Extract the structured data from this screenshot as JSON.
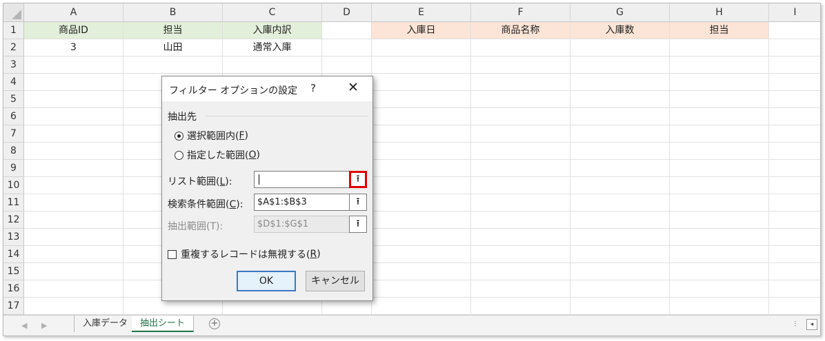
{
  "columns": [
    "A",
    "B",
    "C",
    "D",
    "E",
    "F",
    "G",
    "H",
    "I"
  ],
  "rows": [
    "1",
    "2",
    "3",
    "4",
    "5",
    "6",
    "7",
    "8",
    "9",
    "10",
    "11",
    "12",
    "13",
    "14",
    "15",
    "16",
    "17"
  ],
  "cells": {
    "A1": "商品ID",
    "B1": "担当",
    "C1": "入庫内訳",
    "E1": "入庫日",
    "F1": "商品名称",
    "G1": "入庫数",
    "H1": "担当",
    "A2": "3",
    "B2": "山田",
    "C2": "通常入庫"
  },
  "colors": {
    "criteria_header": "#e2efda",
    "output_header": "#fce4d6",
    "highlight": "#e00000",
    "active_tab": "#217346"
  },
  "dialog": {
    "title": "フィルター オプションの設定",
    "help": "?",
    "close": "✕",
    "group_label": "抽出先",
    "radio_in_place": {
      "text": "選択範囲内(",
      "key": "F",
      "end": ")",
      "checked": true
    },
    "radio_copy": {
      "text": "指定した範囲(",
      "key": "O",
      "end": ")",
      "checked": false
    },
    "list_range": {
      "text": "リスト範囲(",
      "key": "L",
      "end": "):",
      "value": ""
    },
    "criteria_range": {
      "text": "検索条件範囲(",
      "key": "C",
      "end": "):",
      "value": "$A$1:$B$3"
    },
    "copy_to": {
      "label": "抽出範囲(T):",
      "value": "$D$1:$G$1",
      "disabled": true
    },
    "unique_only": {
      "text": "重複するレコードは無視する(",
      "key": "R",
      "end": ")",
      "checked": false
    },
    "ok_label": "OK",
    "cancel_label": "キャンセル",
    "collapse_glyph": "⭱"
  },
  "sheets": {
    "tabs": [
      {
        "label": "入庫データ",
        "active": false
      },
      {
        "label": "抽出シート",
        "active": true
      }
    ],
    "add_glyph": "+",
    "nav_prev": "◀",
    "nav_next": "▶",
    "more": "⁝",
    "scroll_left": "◂"
  }
}
